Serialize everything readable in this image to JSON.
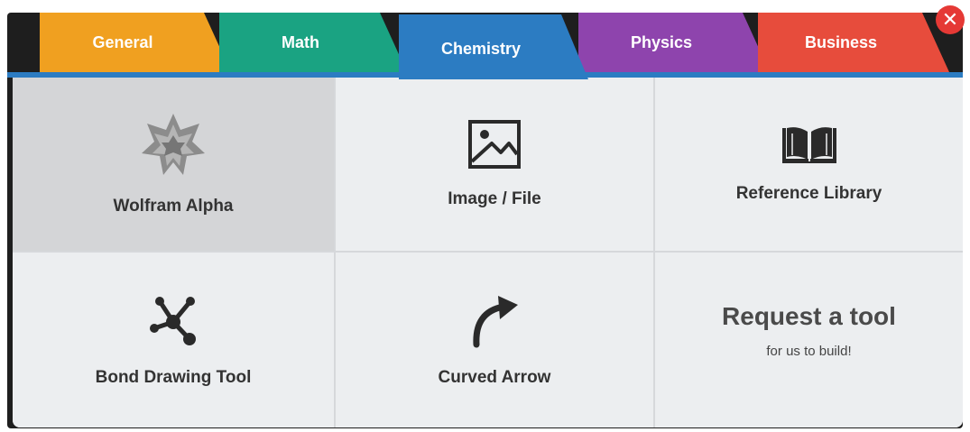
{
  "tabs": [
    {
      "label": "General",
      "color": "#f0a020"
    },
    {
      "label": "Math",
      "color": "#1aa382"
    },
    {
      "label": "Chemistry",
      "color": "#2c7cc2",
      "active": true
    },
    {
      "label": "Physics",
      "color": "#8e44ad"
    },
    {
      "label": "Business",
      "color": "#e74c3c"
    }
  ],
  "close_button": {
    "label": "✕",
    "color": "#e53935"
  },
  "tools": {
    "wolfram": {
      "label": "Wolfram Alpha",
      "icon": "wolfram-star-icon"
    },
    "image": {
      "label": "Image / File",
      "icon": "image-icon"
    },
    "reference": {
      "label": "Reference Library",
      "icon": "book-icon"
    },
    "bond": {
      "label": "Bond Drawing Tool",
      "icon": "molecule-icon"
    },
    "arrow": {
      "label": "Curved Arrow",
      "icon": "curved-arrow-icon"
    },
    "request": {
      "title": "Request a tool",
      "subtitle": "for us to build!"
    }
  }
}
